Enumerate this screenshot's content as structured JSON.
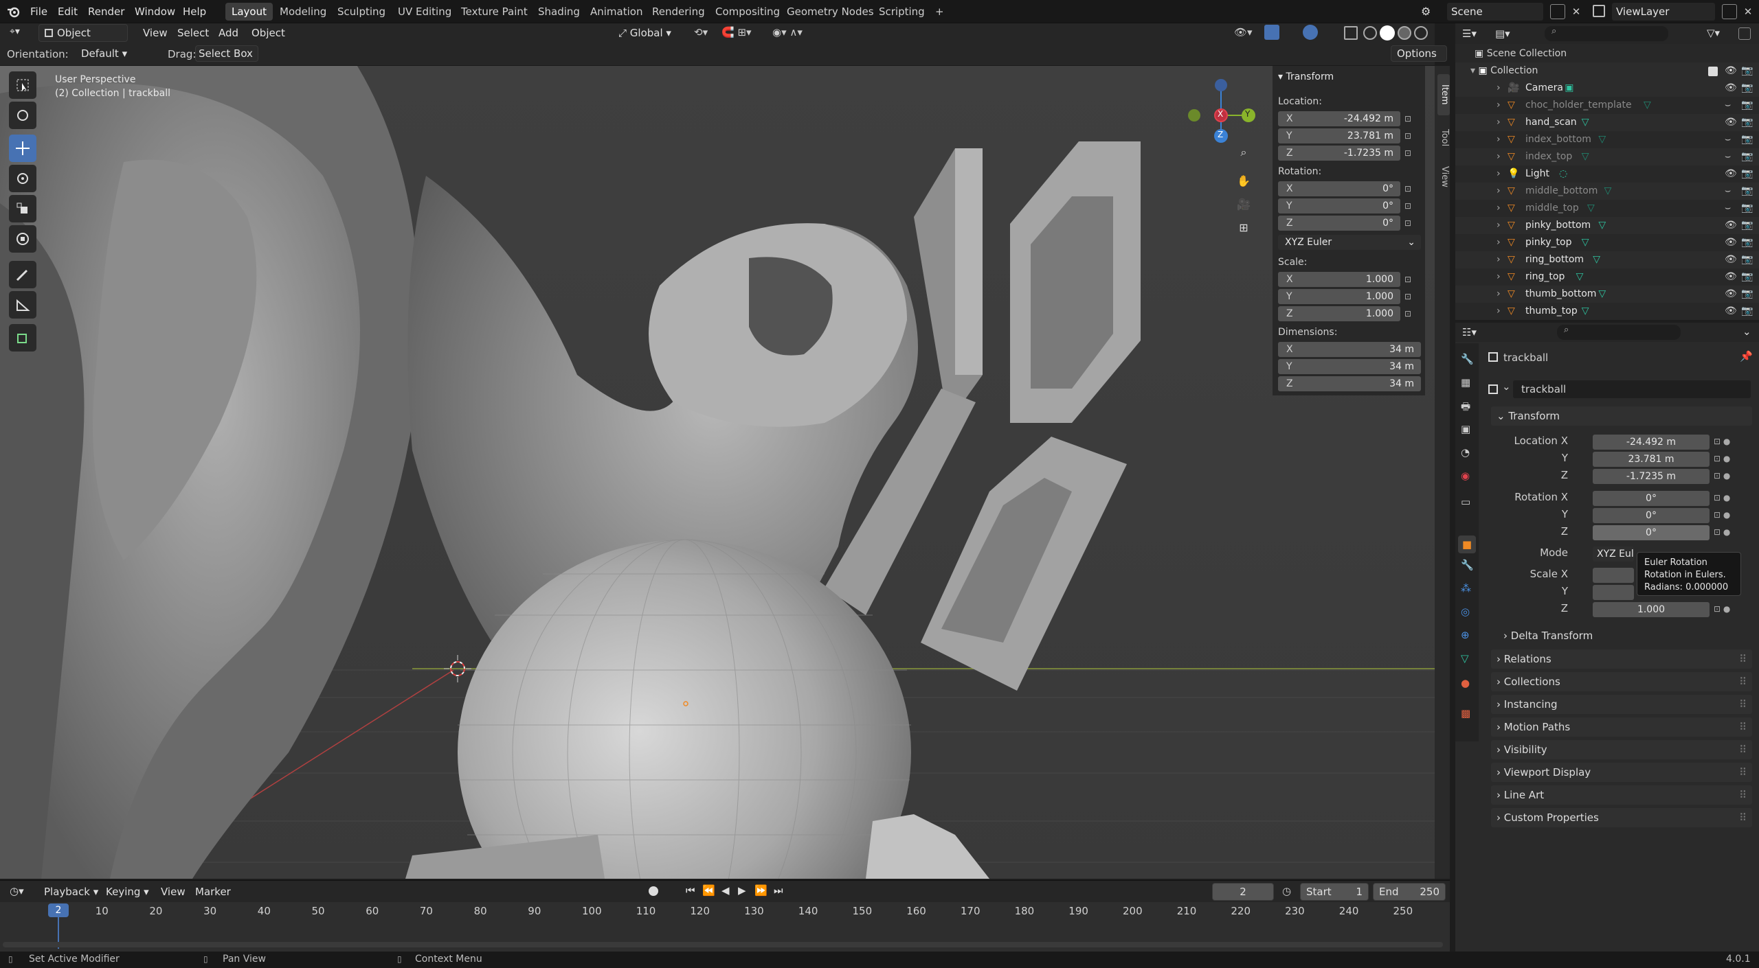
{
  "topbar": {
    "menu": [
      "File",
      "Edit",
      "Render",
      "Window",
      "Help"
    ],
    "workspaces": [
      "Layout",
      "Modeling",
      "Sculpting",
      "UV Editing",
      "Texture Paint",
      "Shading",
      "Animation",
      "Rendering",
      "Compositing",
      "Geometry Nodes",
      "Scripting"
    ],
    "add_tab": "+",
    "scene_label": "Scene",
    "view_layer_label": "ViewLayer"
  },
  "viewport_header": {
    "mode": "Object Mode",
    "menus": [
      "View",
      "Select",
      "Add",
      "Object"
    ],
    "transform_orientation": "Global",
    "orientation_label": "Orientation:",
    "orientation_value": "Default",
    "drag_label": "Drag:",
    "drag_value": "Select Box",
    "options": "Options"
  },
  "viewport": {
    "perspective": "User Perspective",
    "collection_info": "(2) Collection | trackball",
    "gizmo_axes": [
      "X",
      "Y",
      "Z"
    ]
  },
  "npanel": {
    "title": "Transform",
    "location_label": "Location:",
    "location": {
      "x": "-24.492 m",
      "y": "23.781 m",
      "z": "-1.7235 m"
    },
    "rotation_label": "Rotation:",
    "rotation": {
      "x": "0°",
      "y": "0°",
      "z": "0°"
    },
    "rotation_mode": "XYZ Euler",
    "scale_label": "Scale:",
    "scale": {
      "x": "1.000",
      "y": "1.000",
      "z": "1.000"
    },
    "dimensions_label": "Dimensions:",
    "dimensions": {
      "x": "34 m",
      "y": "34 m",
      "z": "34 m"
    },
    "tabs": [
      "Item",
      "Tool",
      "View"
    ]
  },
  "outliner": {
    "root": "Scene Collection",
    "collection": "Collection",
    "items": [
      {
        "name": "Camera",
        "kind": "camera",
        "dim": false
      },
      {
        "name": "choc_holder_template",
        "kind": "mesh",
        "dim": true
      },
      {
        "name": "hand_scan",
        "kind": "mesh",
        "dim": false
      },
      {
        "name": "index_bottom",
        "kind": "mesh",
        "dim": true
      },
      {
        "name": "index_top",
        "kind": "mesh",
        "dim": true
      },
      {
        "name": "Light",
        "kind": "light",
        "dim": false
      },
      {
        "name": "middle_bottom",
        "kind": "mesh",
        "dim": true
      },
      {
        "name": "middle_top",
        "kind": "mesh",
        "dim": true
      },
      {
        "name": "pinky_bottom",
        "kind": "mesh",
        "dim": false
      },
      {
        "name": "pinky_top",
        "kind": "mesh",
        "dim": false
      },
      {
        "name": "ring_bottom",
        "kind": "mesh",
        "dim": false
      },
      {
        "name": "ring_top",
        "kind": "mesh",
        "dim": false
      },
      {
        "name": "thumb_bottom",
        "kind": "mesh",
        "dim": false
      },
      {
        "name": "thumb_top",
        "kind": "mesh",
        "dim": false
      }
    ]
  },
  "properties": {
    "object_name": "trackball",
    "datablock_name": "trackball",
    "transform_title": "Transform",
    "location_x_label": "Location X",
    "y_label": "Y",
    "z_label": "Z",
    "location": {
      "x": "-24.492 m",
      "y": "23.781 m",
      "z": "-1.7235 m"
    },
    "rotation_x_label": "Rotation X",
    "rotation": {
      "x": "0°",
      "y": "0°",
      "z": "0°"
    },
    "mode_label": "Mode",
    "mode_value": "XYZ Eule",
    "scale_x_label": "Scale X",
    "scale_z": "1.000",
    "tooltip": {
      "line1": "Euler Rotation",
      "line2": "Rotation in Eulers.",
      "line3": "Radians: 0.000000"
    },
    "delta_transform": "Delta Transform",
    "panels": [
      "Relations",
      "Collections",
      "Instancing",
      "Motion Paths",
      "Visibility",
      "Viewport Display",
      "Line Art",
      "Custom Properties"
    ]
  },
  "timeline": {
    "menus": [
      "Playback",
      "Keying",
      "View",
      "Marker"
    ],
    "current_frame": "2",
    "start_label": "Start",
    "start": "1",
    "end_label": "End",
    "end": "250",
    "ticks": [
      "10",
      "20",
      "30",
      "40",
      "50",
      "60",
      "70",
      "80",
      "90",
      "100",
      "110",
      "120",
      "130",
      "140",
      "150",
      "160",
      "170",
      "180",
      "190",
      "200",
      "210",
      "220",
      "230",
      "240",
      "250"
    ],
    "playhead": "2"
  },
  "statusbar": {
    "left": "Set Active Modifier",
    "middle": "Pan View",
    "right": "Context Menu",
    "version": "4.0.1"
  },
  "colors": {
    "accent": "#4772b3",
    "x_axis": "#e0424d",
    "y_axis": "#8ab42b",
    "z_axis": "#3b82d6",
    "mesh_icon": "#2ec4a0",
    "object_orange": "#f08a24"
  }
}
